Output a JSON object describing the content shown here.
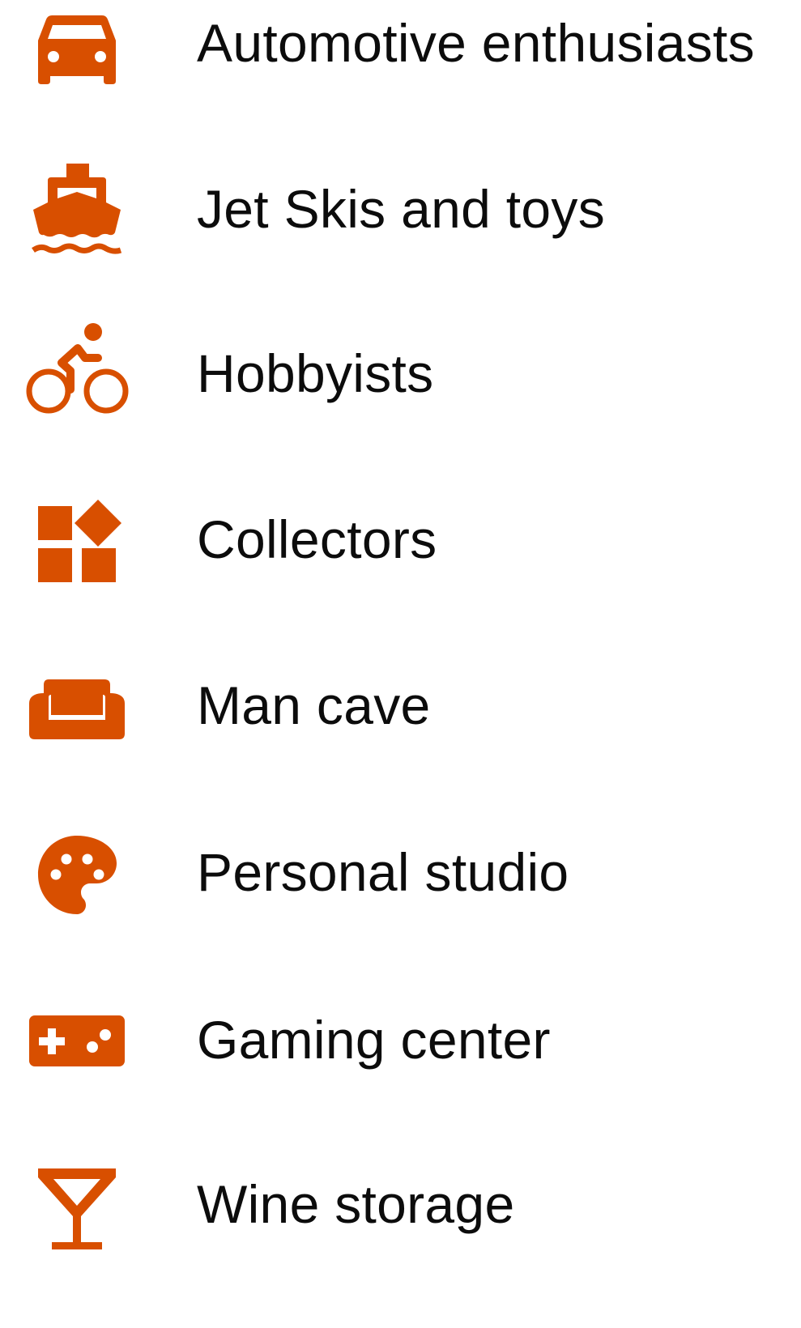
{
  "accent_color": "#d84f00",
  "text_color": "#0c0c0c",
  "items": [
    {
      "label": "Automotive enthusiasts",
      "icon": "car-icon"
    },
    {
      "label": "Jet Skis and toys",
      "icon": "boat-icon"
    },
    {
      "label": "Hobbyists",
      "icon": "bicycle-icon"
    },
    {
      "label": "Collectors",
      "icon": "widgets-icon"
    },
    {
      "label": "Man cave",
      "icon": "couch-icon"
    },
    {
      "label": "Personal studio",
      "icon": "palette-icon"
    },
    {
      "label": "Gaming center",
      "icon": "gamepad-icon"
    },
    {
      "label": "Wine storage",
      "icon": "cocktail-glass-icon"
    }
  ]
}
